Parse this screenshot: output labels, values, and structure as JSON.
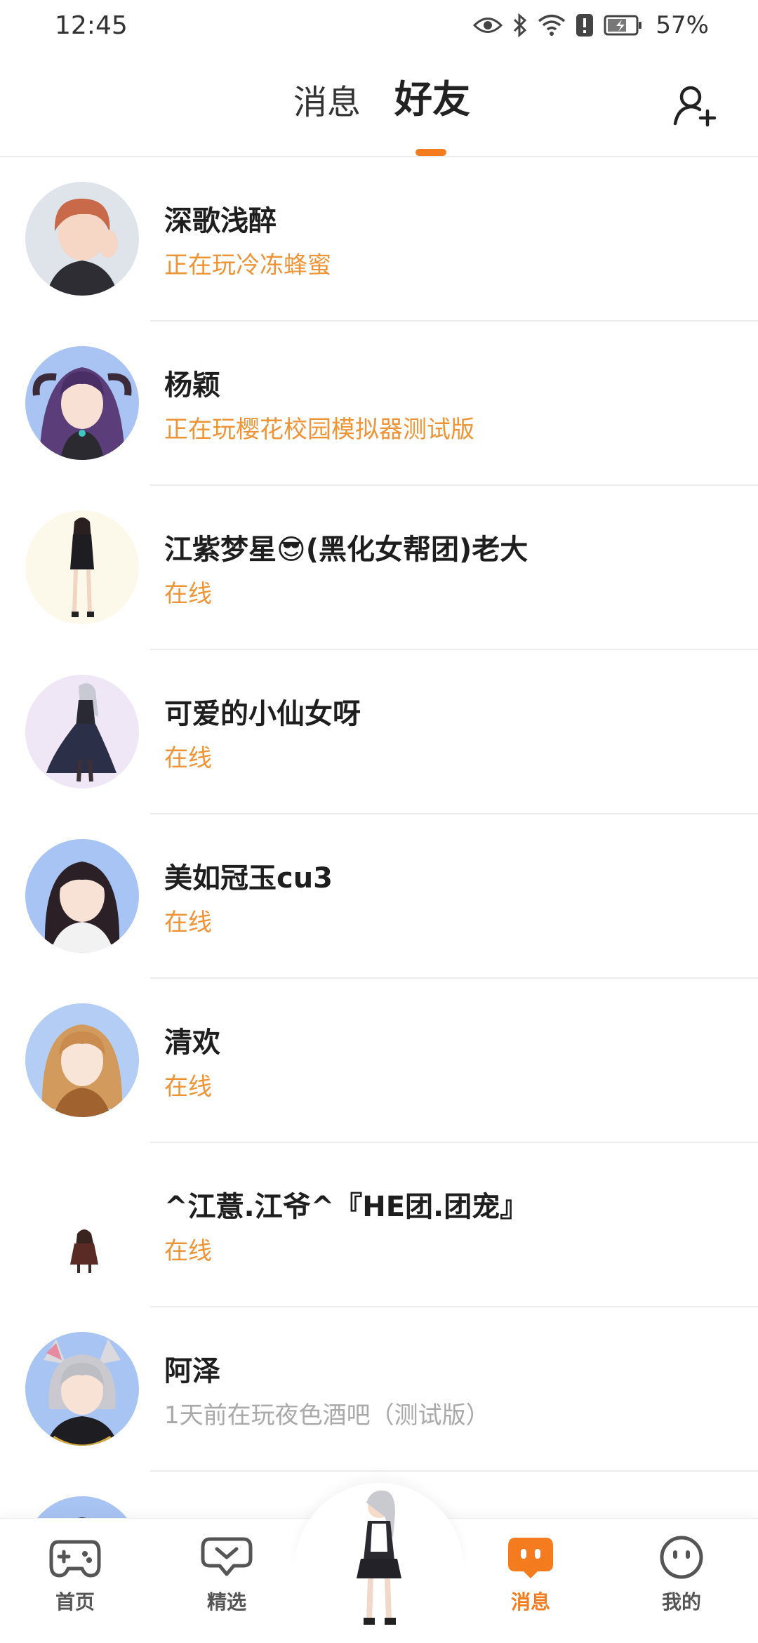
{
  "status_bar": {
    "time": "12:45",
    "battery_percent": "57%",
    "icons": [
      "eye-icon",
      "bluetooth-icon",
      "wifi-icon",
      "alert-icon",
      "battery-icon"
    ]
  },
  "header": {
    "tabs": [
      {
        "label": "消息",
        "active": false
      },
      {
        "label": "好友",
        "active": true
      }
    ],
    "add_friend_icon": "add-user-icon",
    "accent_color": "#f57b1f"
  },
  "friends": [
    {
      "name": "深歌浅醉",
      "status": "正在玩冷冻蜂蜜",
      "online": true
    },
    {
      "name": "杨颖",
      "status": "正在玩樱花校园模拟器测试版",
      "online": true
    },
    {
      "name": "江紫梦星😎(黑化女帮团)老大",
      "status": "在线",
      "online": true
    },
    {
      "name": "可爱的小仙女呀",
      "status": "在线",
      "online": true
    },
    {
      "name": "美如冠玉cu3",
      "status": "在线",
      "online": true
    },
    {
      "name": "清欢",
      "status": "在线",
      "online": true
    },
    {
      "name": "^江薏.江爷^『HE团.团宠』",
      "status": "在线",
      "online": true
    },
    {
      "name": "阿泽",
      "status": "1天前在玩夜色酒吧（测试版）",
      "online": false
    }
  ],
  "bottom_nav": {
    "items": [
      {
        "label": "首页",
        "icon": "gamepad-icon",
        "active": false
      },
      {
        "label": "精选",
        "icon": "heart-chat-icon",
        "active": false
      },
      {
        "label": "消息",
        "icon": "message-icon",
        "active": true
      },
      {
        "label": "我的",
        "icon": "face-icon",
        "active": false
      }
    ],
    "center_icon": "character-avatar-icon"
  }
}
